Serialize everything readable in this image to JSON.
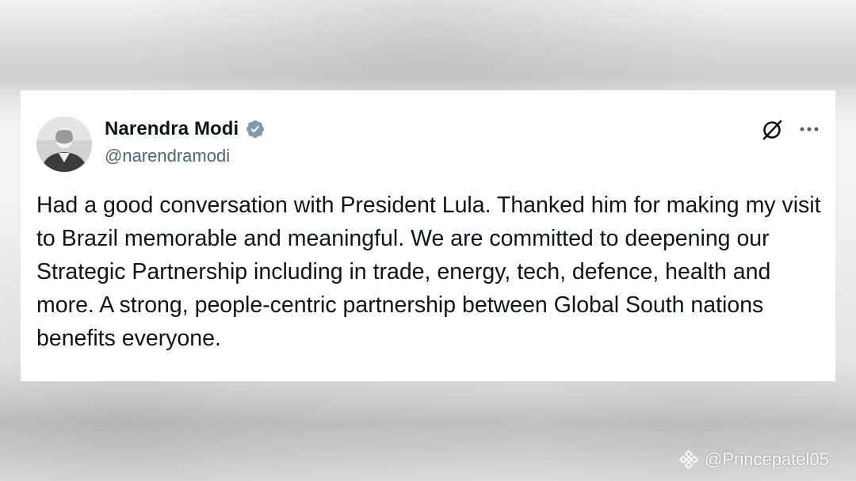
{
  "post": {
    "author": {
      "display_name": "Narendra Modi",
      "handle": "@narendramodi",
      "verified": true,
      "verified_badge_color": "#829aab"
    },
    "text": "Had a good conversation with President Lula. Thanked him for making my visit to Brazil memorable and meaningful. We are committed to deepening our Strategic Partnership including in trade, energy, tech, defence, health and more. A strong, people-centric partnership between Global South nations benefits everyone.",
    "actions": {
      "grok_icon": "grok-icon",
      "more_icon": "more-options-icon"
    }
  },
  "watermark": {
    "logo_icon": "binance-logo-icon",
    "text": "@Princepatel05"
  },
  "colors": {
    "text_primary": "#0f1419",
    "text_secondary": "#536471",
    "card_background": "#ffffff"
  }
}
